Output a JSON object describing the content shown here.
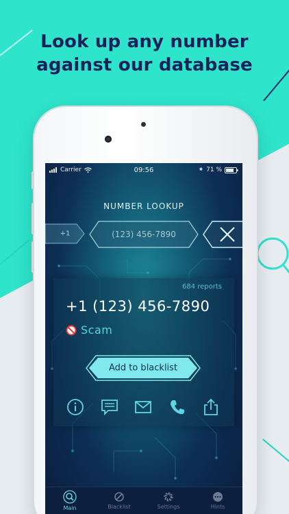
{
  "headline": {
    "line1": "Look up any number",
    "line2": "against our database"
  },
  "status_bar": {
    "carrier": "Carrier",
    "time": "09:56",
    "battery": "71 %"
  },
  "lookup": {
    "title": "NUMBER LOOKUP",
    "country_code": "+1",
    "phone_number": "(123) 456-7890"
  },
  "result": {
    "reports": "684 reports",
    "number": "+1 (123) 456-7890",
    "category": "Scam",
    "add_button": "Add to blacklist"
  },
  "actions": [
    "info-icon",
    "message-icon",
    "mail-icon",
    "phone-icon",
    "share-icon"
  ],
  "tabs": [
    {
      "label": "Main",
      "icon": "search-icon",
      "active": true
    },
    {
      "label": "Blacklist",
      "icon": "block-icon",
      "active": false
    },
    {
      "label": "Settings",
      "icon": "gear-icon",
      "active": false
    },
    {
      "label": "Hints",
      "icon": "more-icon",
      "active": false
    }
  ],
  "colors": {
    "brand_teal": "#2ee5cc",
    "navy": "#16225a",
    "accent_cyan": "#5fd6e4"
  }
}
